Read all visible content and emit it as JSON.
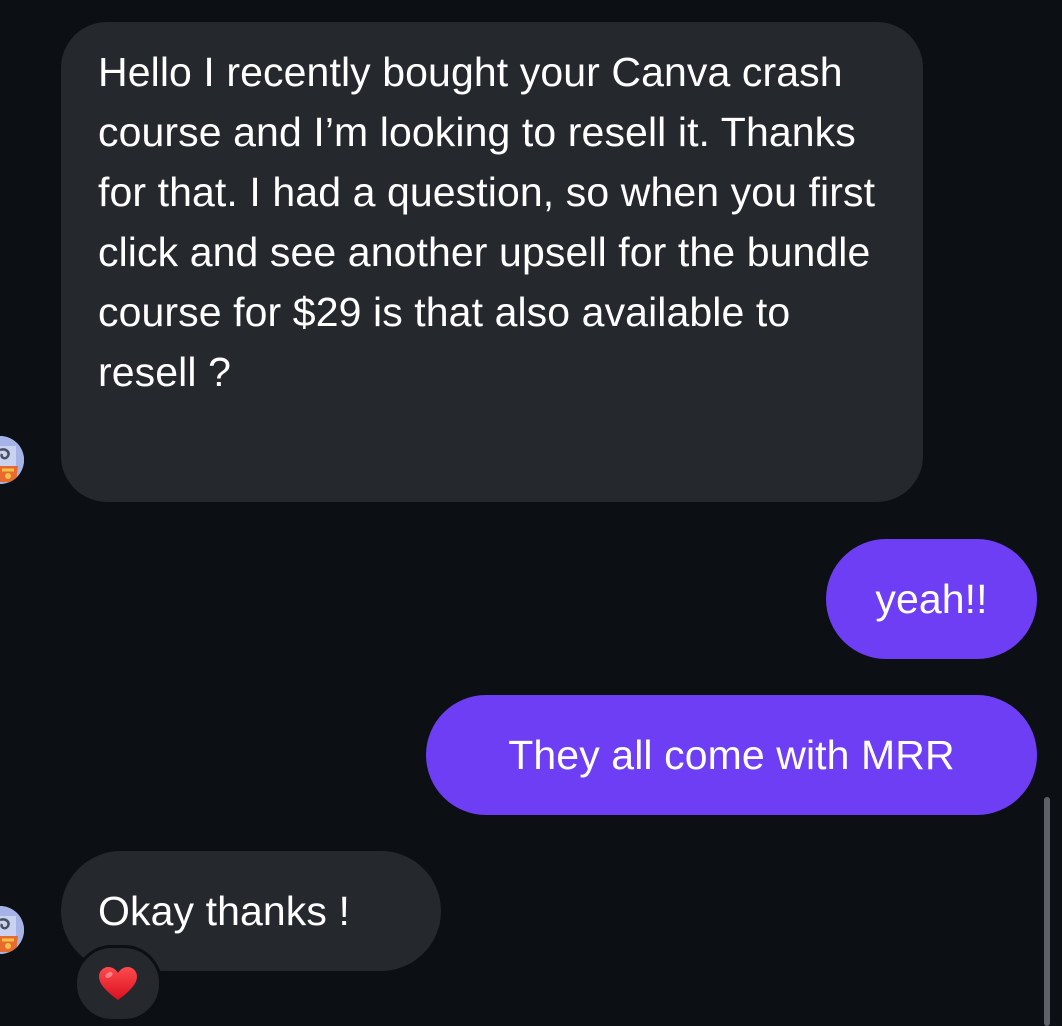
{
  "messages": [
    {
      "direction": "incoming",
      "text": "Hello I recently bought your Canva crash course and I’m looking to resell it. Thanks for that. I had a question, so when you first click and see another upsell for the bundle course for $29 is that also available to resell ?"
    },
    {
      "direction": "outgoing",
      "text": "yeah!!"
    },
    {
      "direction": "outgoing",
      "text": "They all come with MRR"
    },
    {
      "direction": "incoming",
      "text": "Okay thanks !",
      "reaction": "heart-icon"
    }
  ],
  "colors": {
    "background": "#0c0f14",
    "incoming_bubble": "#25282d",
    "outgoing_bubble": "#6e3ef5",
    "reaction_heart": "#e0202d",
    "avatar_bg": "#a6b3e6"
  }
}
